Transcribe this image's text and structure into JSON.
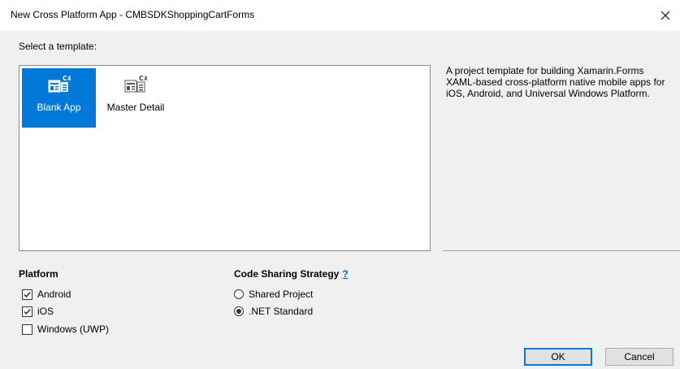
{
  "window": {
    "title": "New Cross Platform App - CMBSDKShoppingCartForms",
    "close_icon": "close-icon"
  },
  "templates": {
    "label": "Select a template:",
    "items": [
      {
        "label": "Blank App",
        "icon": "blank-app-template-icon",
        "selected": true
      },
      {
        "label": "Master Detail",
        "icon": "master-detail-template-icon",
        "selected": false
      }
    ],
    "description": "A project template for building Xamarin.Forms XAML-based cross-platform native mobile apps for iOS, Android, and Universal Windows Platform."
  },
  "platform": {
    "title": "Platform",
    "options": [
      {
        "label": "Android",
        "checked": true
      },
      {
        "label": "iOS",
        "checked": true
      },
      {
        "label": "Windows (UWP)",
        "checked": false
      }
    ]
  },
  "code_sharing": {
    "title": "Code Sharing Strategy",
    "help_label": "?",
    "options": [
      {
        "label": "Shared Project",
        "selected": false
      },
      {
        "label": ".NET Standard",
        "selected": true
      }
    ]
  },
  "buttons": {
    "ok": "OK",
    "cancel": "Cancel"
  },
  "colors": {
    "accent": "#0078d7",
    "dialog_background": "#f0f0f0",
    "csharp_badge": "#68217a"
  }
}
